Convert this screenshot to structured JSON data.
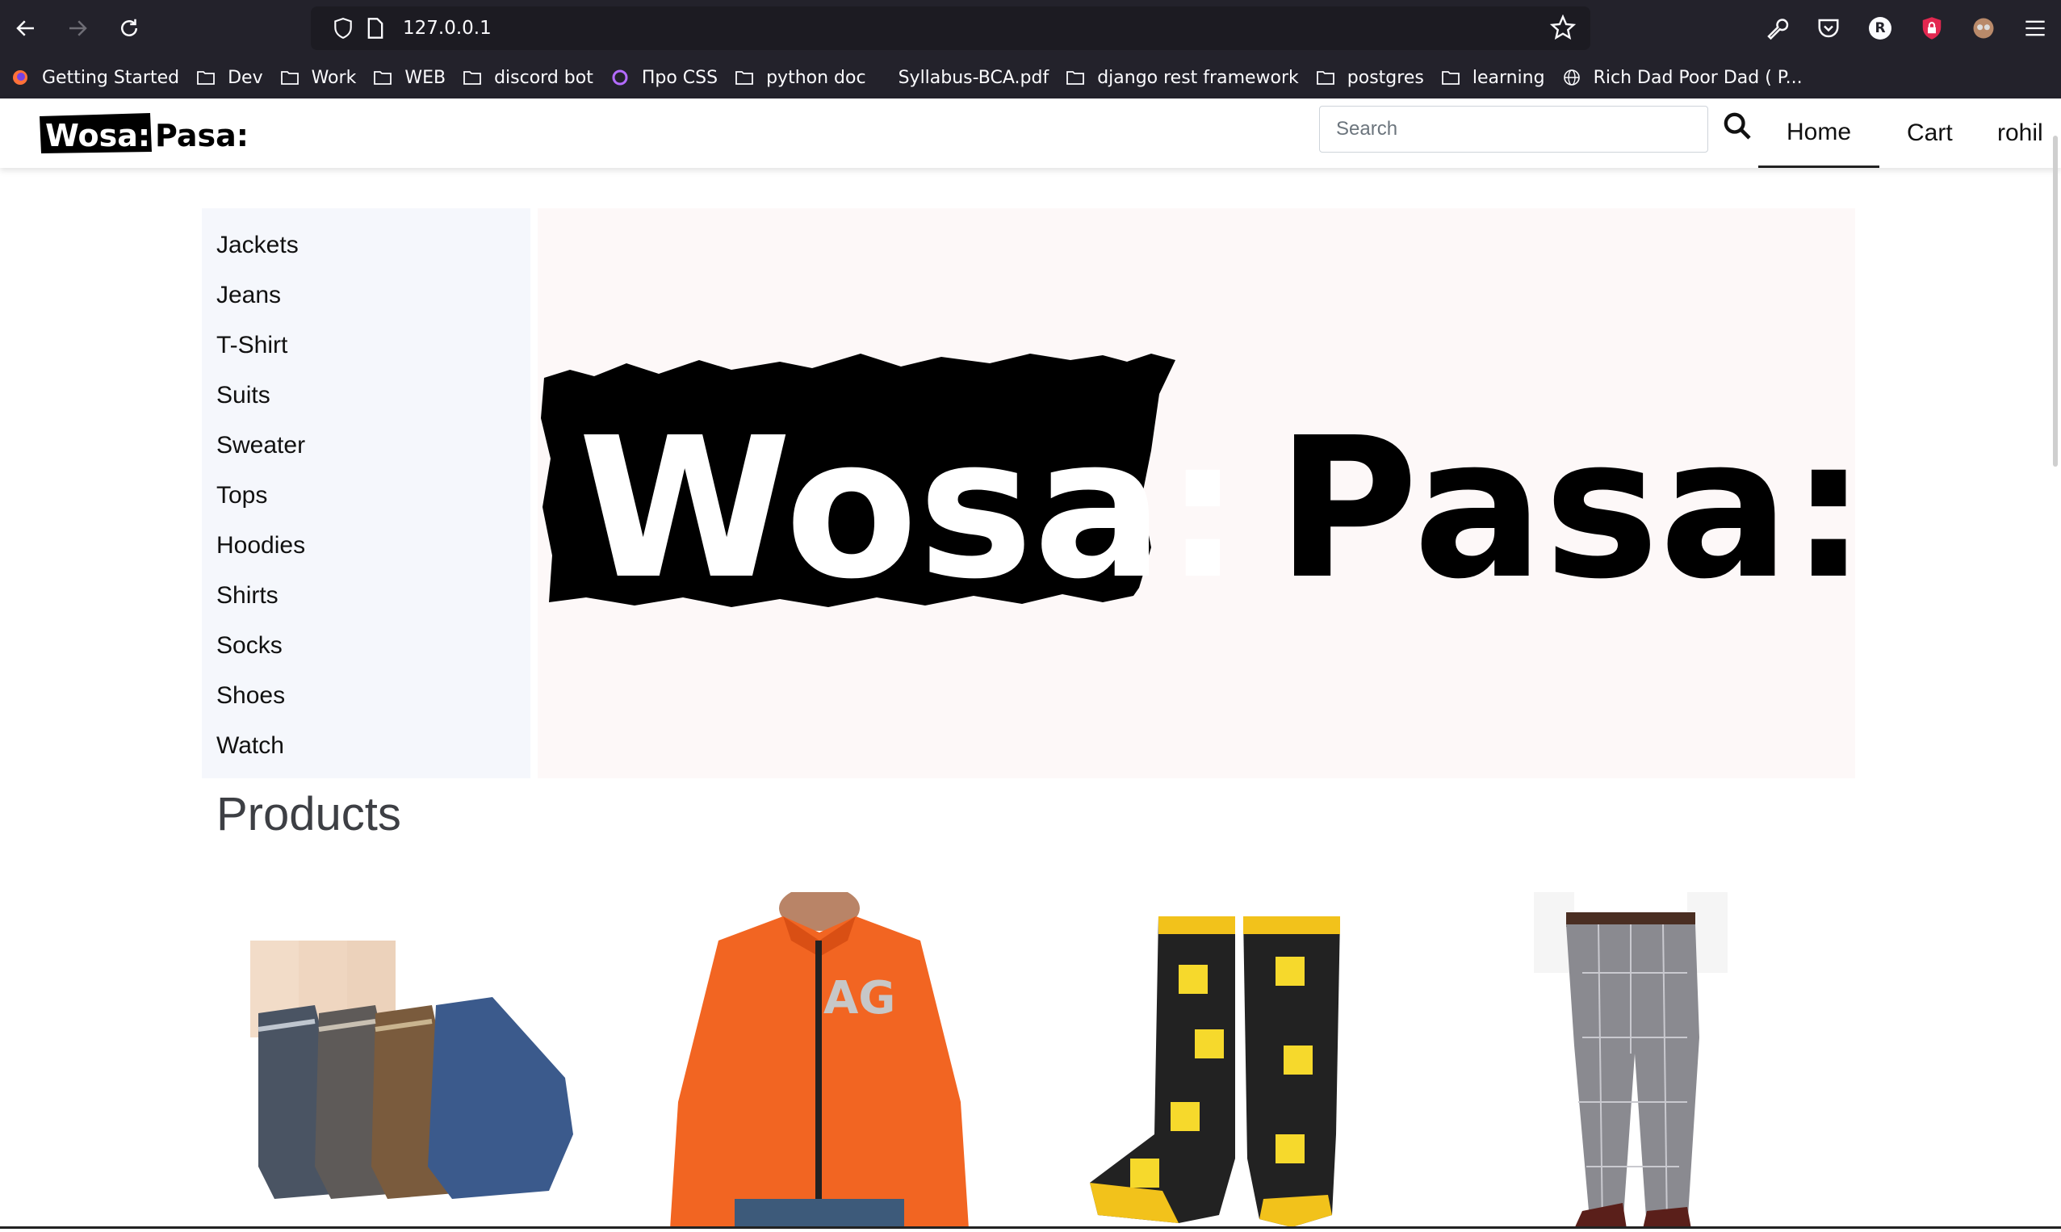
{
  "browser": {
    "url": "127.0.0.1",
    "profile_initial": "R"
  },
  "bookmarks": [
    {
      "label": "Getting Started",
      "icon": "firefox-icon"
    },
    {
      "label": "Dev",
      "icon": "folder-icon"
    },
    {
      "label": "Work",
      "icon": "folder-icon"
    },
    {
      "label": "WEB",
      "icon": "folder-icon"
    },
    {
      "label": "discord bot",
      "icon": "folder-icon"
    },
    {
      "label": "Про CSS",
      "icon": "ring-icon"
    },
    {
      "label": "python doc",
      "icon": "folder-icon"
    },
    {
      "label": "Syllabus-BCA.pdf",
      "icon": "none"
    },
    {
      "label": "django rest framework",
      "icon": "folder-icon"
    },
    {
      "label": "postgres",
      "icon": "folder-icon"
    },
    {
      "label": "learning",
      "icon": "folder-icon"
    },
    {
      "label": "Rich Dad Poor Dad ( P...",
      "icon": "globe-icon"
    }
  ],
  "site": {
    "logo_left": "Wosa:",
    "logo_right": "Pasa:",
    "search_placeholder": "Search",
    "nav": {
      "home": "Home",
      "cart": "Cart",
      "user": "rohil"
    }
  },
  "categories": [
    "Jackets",
    "Jeans",
    "T-Shirt",
    "Suits",
    "Sweater",
    "Tops",
    "Hoodies",
    "Shirts",
    "Socks",
    "Shoes",
    "Watch"
  ],
  "products_heading": "Products",
  "products": [
    {
      "name": "ankle-socks"
    },
    {
      "name": "orange-jacket"
    },
    {
      "name": "spongebob-socks"
    },
    {
      "name": "check-trousers"
    }
  ],
  "colors": {
    "chrome_bg": "#23222b",
    "urlbar_bg": "#1c1b22",
    "sidebar_bg": "#f5f7fc",
    "banner_bg": "#fdf8f8",
    "heading": "#3d3f44"
  }
}
